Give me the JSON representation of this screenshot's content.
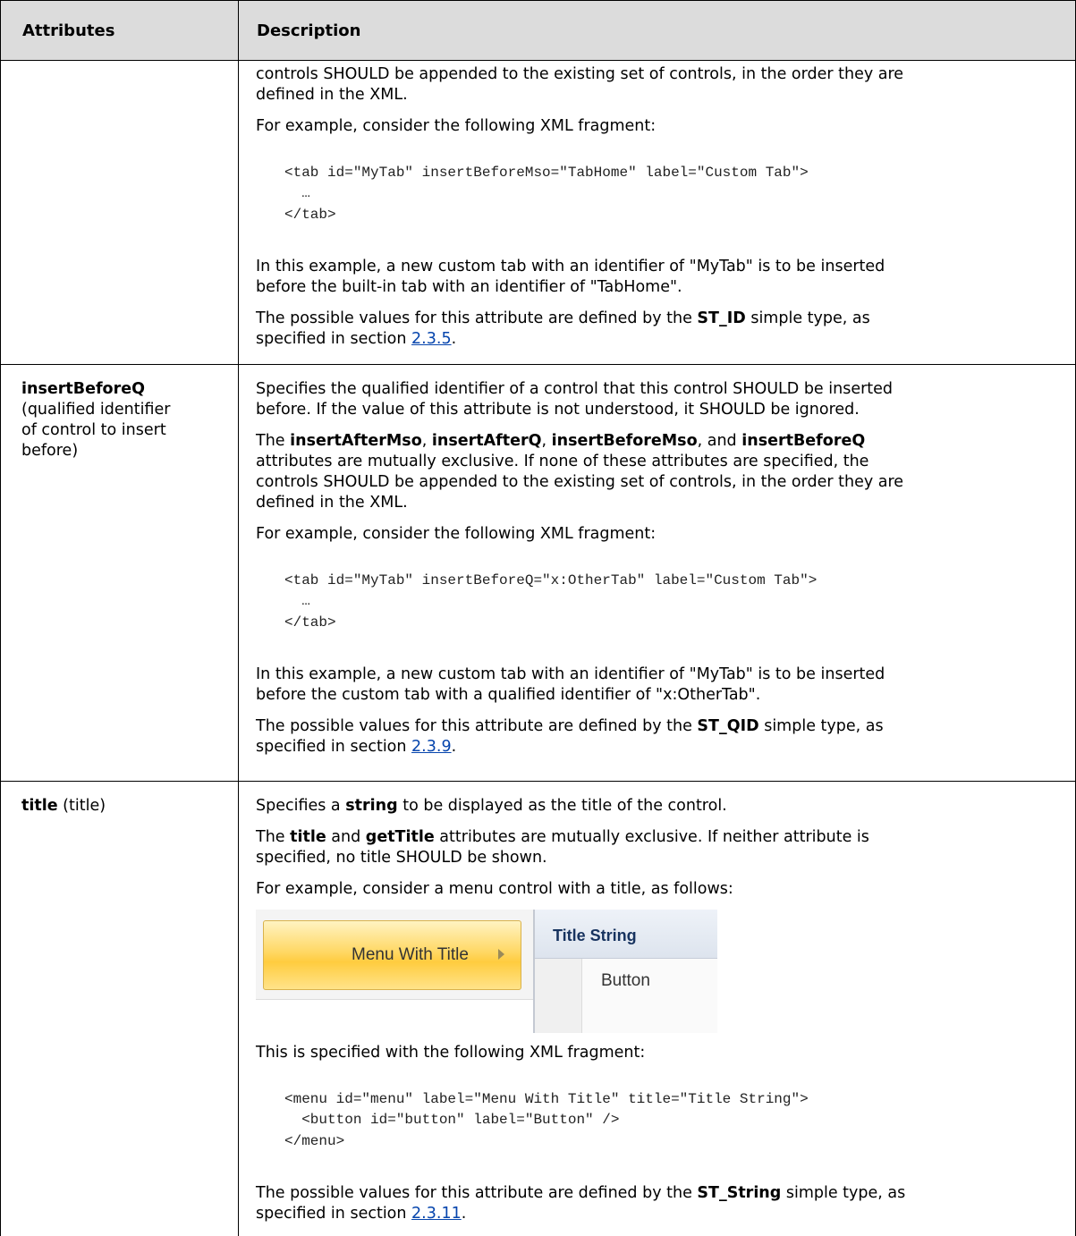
{
  "table": {
    "headers": {
      "attributes": "Attributes",
      "description": "Description"
    }
  },
  "row_continued": {
    "p1_l1": "controls SHOULD be appended to the existing set of controls, in the order they are",
    "p1_l2": "defined in the XML.",
    "p2": "For example, consider the following XML fragment:",
    "code_l1": "<tab id=\"MyTab\" insertBeforeMso=\"TabHome\" label=\"Custom Tab\">",
    "code_l2": "  …",
    "code_l3": "</tab>",
    "p3_l1": "In this example, a new custom tab with an identifier of \"MyTab\" is to be inserted",
    "p3_l2": "before the built-in tab with an identifier of \"TabHome\".",
    "p4_pre": "The possible values for this attribute are defined by the ",
    "p4_bold": "ST_ID",
    "p4_post": " simple type, as",
    "p4_l2_pre": "specified in section ",
    "p4_link": "2.3.5",
    "p4_l2_post": "."
  },
  "row_insertBeforeQ": {
    "attr_name": "insertBeforeQ",
    "attr_desc_l1": "(qualified identifier",
    "attr_desc_l2": "of control to insert",
    "attr_desc_l3": "before)",
    "p1_l1": "Specifies the qualified identifier of a control that this control SHOULD be inserted",
    "p1_l2": "before. If the value of this attribute is not understood, it SHOULD be ignored.",
    "p2_b1": "insertAfterMso",
    "p2_s1": ", ",
    "p2_b2": "insertAfterQ",
    "p2_s2": ", ",
    "p2_b3": "insertBeforeMso",
    "p2_s3": ", and ",
    "p2_b4": "insertBeforeQ",
    "p2_pre": "The ",
    "p2_l2": "attributes are mutually exclusive. If none of these attributes are specified, the",
    "p2_l3": "controls SHOULD be appended to the existing set of controls, in the order they are",
    "p2_l4": "defined in the XML.",
    "p3": "For example, consider the following XML fragment:",
    "code_l1": "<tab id=\"MyTab\" insertBeforeQ=\"x:OtherTab\" label=\"Custom Tab\">",
    "code_l2": "  …",
    "code_l3": "</tab>",
    "p4_l1": "In this example, a new custom tab with an identifier of \"MyTab\" is to be inserted",
    "p4_l2": "before the custom tab with a qualified identifier of \"x:OtherTab\".",
    "p5_pre": "The possible values for this attribute are defined by the ",
    "p5_bold": "ST_QID",
    "p5_post": " simple type, as",
    "p5_l2_pre": "specified in section ",
    "p5_link": "2.3.9",
    "p5_l2_post": "."
  },
  "row_title": {
    "attr_name": "title",
    "attr_desc": " (title)",
    "p1_pre": "Specifies a ",
    "p1_bold": "string",
    "p1_post": " to be displayed as the title of the control.",
    "p2_pre": "The ",
    "p2_b1": "title",
    "p2_mid": " and ",
    "p2_b2": "getTitle",
    "p2_post": " attributes are mutually exclusive. If neither attribute is",
    "p2_l2": "specified, no title SHOULD be shown.",
    "p3": "For example, consider a menu control with a title, as follows:",
    "screenshot": {
      "menu_label": "Menu With Title",
      "title_string": "Title String",
      "button_label": "Button"
    },
    "p4": "This is specified with the following XML fragment:",
    "code_l1": "<menu id=\"menu\" label=\"Menu With Title\" title=\"Title String\">",
    "code_l2": "  <button id=\"button\" label=\"Button\" />",
    "code_l3": "</menu>",
    "p5_pre": "The possible values for this attribute are defined by the ",
    "p5_bold": "ST_String",
    "p5_post": " simple type, as",
    "p5_l2_pre": "specified in section ",
    "p5_link": "2.3.11",
    "p5_l2_post": "."
  }
}
